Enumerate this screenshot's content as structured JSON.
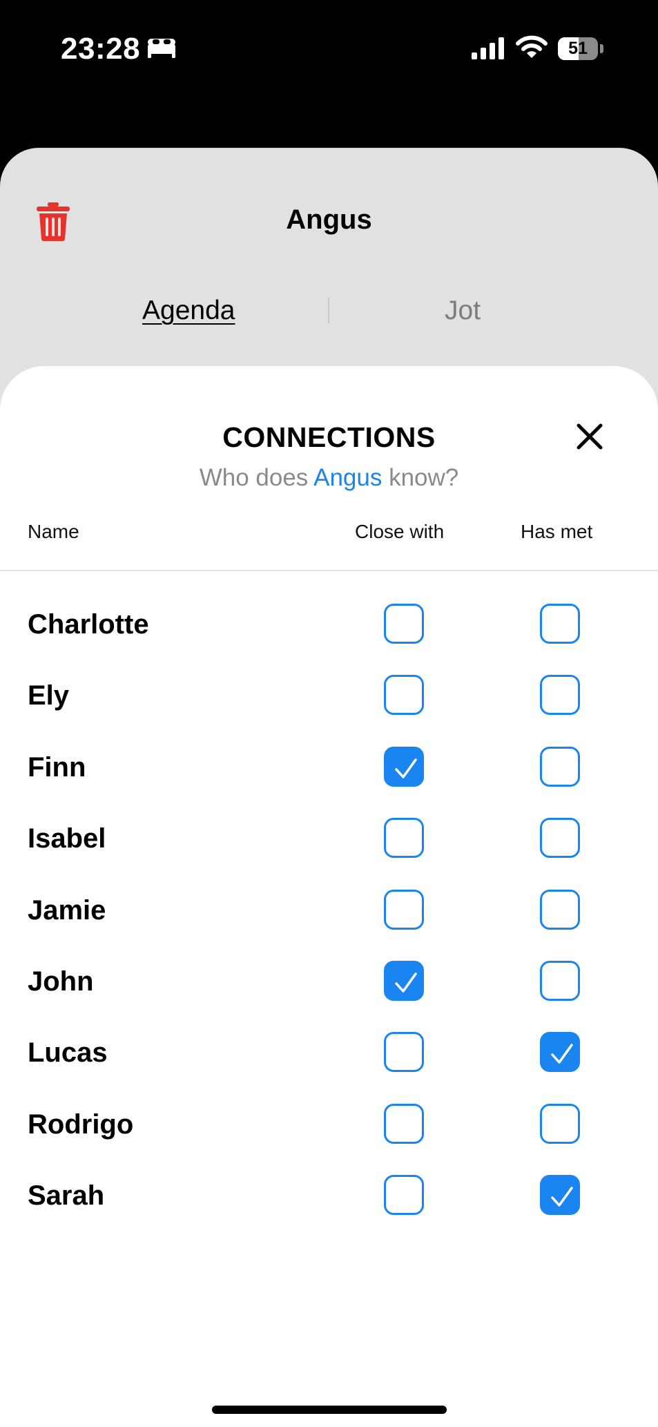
{
  "status_bar": {
    "time": "23:28",
    "battery": "51",
    "battery_level": 0.51,
    "icons": [
      "bed-icon",
      "signal-icon",
      "wifi-icon",
      "battery-icon"
    ]
  },
  "sheet": {
    "title": "Angus",
    "tabs": [
      {
        "label": "Agenda",
        "selected": true
      },
      {
        "label": "Jot",
        "selected": false
      }
    ]
  },
  "connections": {
    "title": "CONNECTIONS",
    "subtitle_prefix": "Who does ",
    "subtitle_name": "Angus",
    "subtitle_suffix": " know?",
    "columns": {
      "name": "Name",
      "close_with": "Close with",
      "has_met": "Has met"
    },
    "people": [
      {
        "name": "Charlotte",
        "close_with": false,
        "has_met": false
      },
      {
        "name": "Ely",
        "close_with": false,
        "has_met": false
      },
      {
        "name": "Finn",
        "close_with": true,
        "has_met": false
      },
      {
        "name": "Isabel",
        "close_with": false,
        "has_met": false
      },
      {
        "name": "Jamie",
        "close_with": false,
        "has_met": false
      },
      {
        "name": "John",
        "close_with": true,
        "has_met": false
      },
      {
        "name": "Lucas",
        "close_with": false,
        "has_met": true
      },
      {
        "name": "Rodrigo",
        "close_with": false,
        "has_met": false
      },
      {
        "name": "Sarah",
        "close_with": false,
        "has_met": true
      }
    ]
  },
  "colors": {
    "accent": "#1a84f0",
    "trash": "#e5342b",
    "back_sheet": "#e1e1e1",
    "muted_text": "#8a8a8a"
  }
}
